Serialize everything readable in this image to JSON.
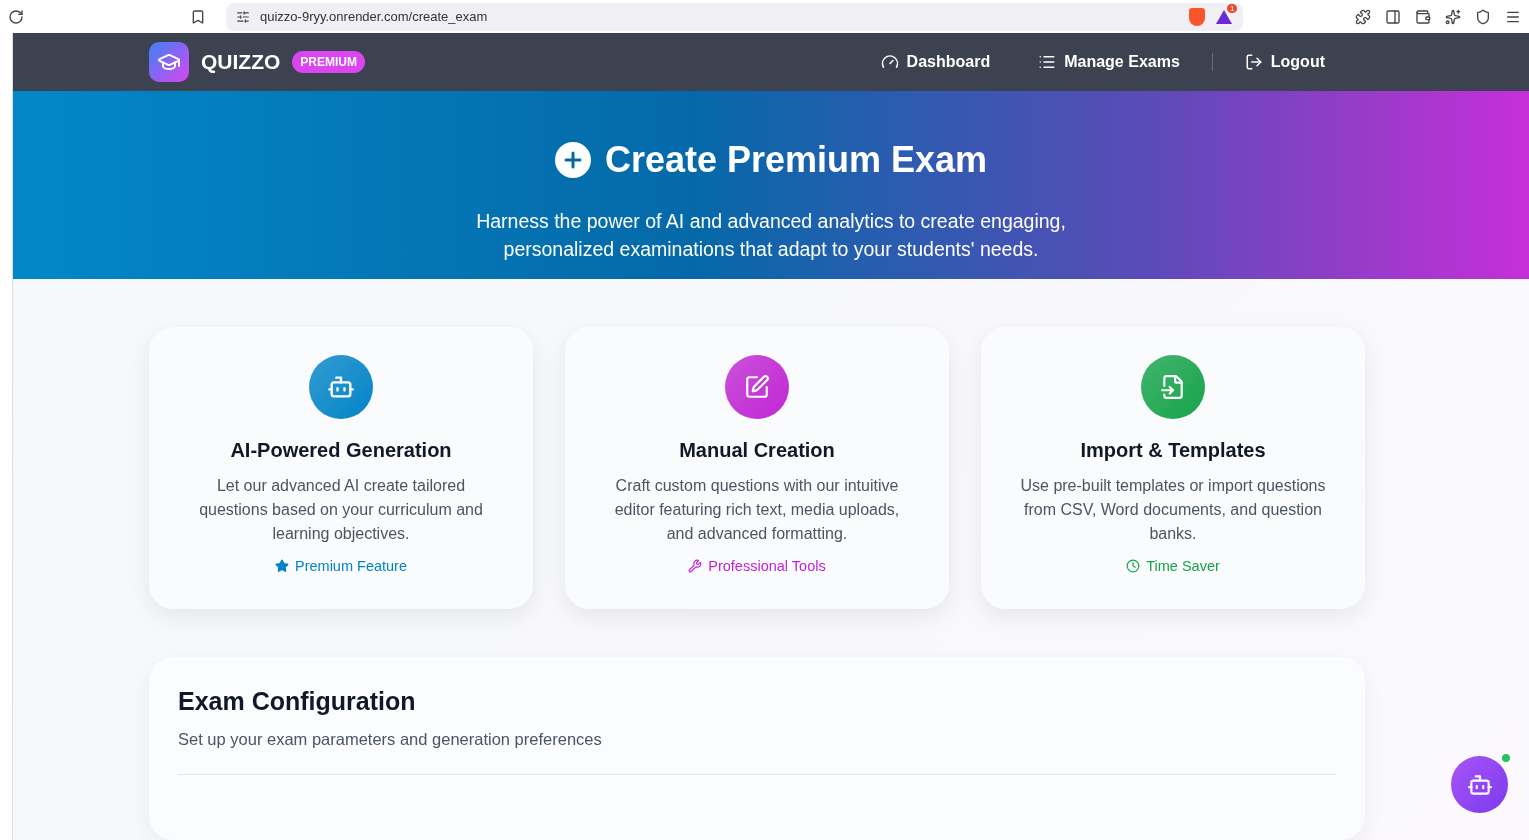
{
  "browser": {
    "url": "quizzo-9ryy.onrender.com/create_exam",
    "notification_count": "1"
  },
  "nav": {
    "brand": "QUIZZO",
    "badge": "PREMIUM",
    "links": [
      {
        "kind": "dashboard",
        "label": "Dashboard"
      },
      {
        "kind": "list",
        "label": "Manage Exams"
      },
      {
        "kind": "logout",
        "label": "Logout"
      }
    ]
  },
  "hero": {
    "title": "Create Premium Exam",
    "subtitle": "Harness the power of AI and advanced analytics to create engaging, personalized examinations that adapt to your students' needs."
  },
  "features": [
    {
      "kind": "ai",
      "color": "#0284c7",
      "title": "AI-Powered Generation",
      "text": "Let our advanced AI create tailored questions based on your curriculum and learning objectives.",
      "tag": "Premium Feature"
    },
    {
      "kind": "manual",
      "color": "#c026d3",
      "title": "Manual Creation",
      "text": "Craft custom questions with our intuitive editor featuring rich text, media uploads, and advanced formatting.",
      "tag": "Professional Tools"
    },
    {
      "kind": "import",
      "color": "#16a34a",
      "title": "Import & Templates",
      "text": "Use pre-built templates or import questions from CSV, Word documents, and question banks.",
      "tag": "Time Saver"
    }
  ],
  "config": {
    "title": "Exam Configuration",
    "subtitle": "Set up your exam parameters and generation preferences"
  },
  "chat": {
    "online": true
  }
}
